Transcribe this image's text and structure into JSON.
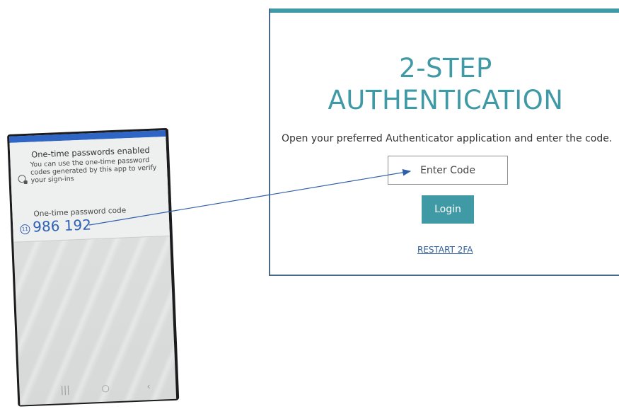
{
  "login": {
    "title_line1": "2-STEP",
    "title_line2": "AUTHENTICATION",
    "instructions": "Open your preferred Authenticator application and enter the code.",
    "code_placeholder": "Enter Code",
    "login_label": "Login",
    "restart_label": "RESTART 2FA"
  },
  "phone": {
    "notification_title": "One-time passwords enabled",
    "notification_body": "You can use the one-time password codes generated by this app to verify your sign-ins",
    "code_label": "One-time password code",
    "timer": "11",
    "otp_code": "986 192",
    "nav": {
      "recent": "|||",
      "home": "○",
      "back": "‹"
    }
  },
  "colors": {
    "accent": "#3f9aa5",
    "link": "#2f5fa0",
    "phone_bar": "#2f65c4",
    "otp_text": "#2f62b5",
    "arrow": "#2f5fa8"
  }
}
